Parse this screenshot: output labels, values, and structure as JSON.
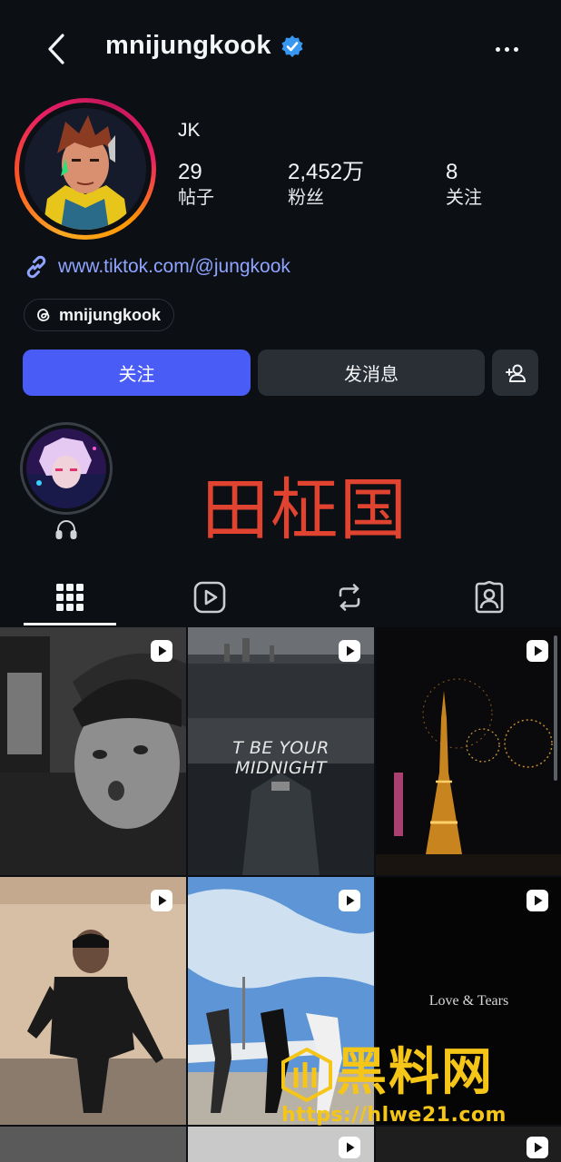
{
  "header": {
    "username": "mnijungkook",
    "verified": true
  },
  "profile": {
    "display_name": "JK",
    "stats": [
      {
        "value": "29",
        "label": "帖子"
      },
      {
        "value": "2,452万",
        "label": "粉丝"
      },
      {
        "value": "8",
        "label": "关注"
      }
    ],
    "link": "www.tiktok.com/@jungkook",
    "threads_handle": "mnijungkook"
  },
  "actions": {
    "follow": "关注",
    "message": "发消息"
  },
  "overlay_text": "田柾国",
  "tabs": [
    "grid",
    "reels",
    "reposts",
    "tagged"
  ],
  "grid_items": [
    {
      "caption": "",
      "type": "reel"
    },
    {
      "caption": "T BE YOUR MIDNIGHT",
      "type": "reel"
    },
    {
      "caption": "",
      "type": "reel"
    },
    {
      "caption": "",
      "type": "reel"
    },
    {
      "caption": "",
      "type": "reel"
    },
    {
      "caption": "Love & Tears",
      "type": "reel"
    }
  ],
  "watermark": {
    "title": "黑料网",
    "url": "https://hlwe21.com"
  },
  "colors": {
    "background": "#0c0f14",
    "follow_button": "#4a5cf6",
    "secondary_button": "#2a2f36",
    "link": "#8ea4ff",
    "verified": "#3897f0",
    "overlay_text": "#e0432f"
  }
}
